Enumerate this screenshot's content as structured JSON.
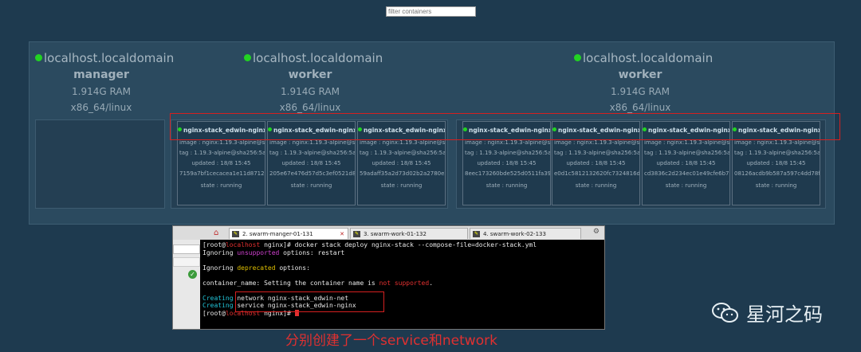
{
  "filter": {
    "placeholder": "filter containers"
  },
  "nodes": [
    {
      "host": "localhost.localdomain",
      "role": "manager",
      "ram": "1.914G RAM",
      "arch": "x86_64/linux"
    },
    {
      "host": "localhost.localdomain",
      "role": "worker",
      "ram": "1.914G RAM",
      "arch": "x86_64/linux"
    },
    {
      "host": "localhost.localdomain",
      "role": "worker",
      "ram": "1.914G RAM",
      "arch": "x86_64/linux"
    }
  ],
  "tasks": [
    {
      "name": "nginx-stack_edwin-nginx",
      "image": "image : nginx:1.19.3-alpine@sha25",
      "tag": "tag : 1.19.3-alpine@sha256:5aa44b",
      "updated": "updated : 18/8 15:45",
      "id": "7159a7bf1cecacea1e11d871214a1",
      "state": "state : running"
    },
    {
      "name": "nginx-stack_edwin-nginx",
      "image": "image : nginx:1.19.3-alpine@sha25",
      "tag": "tag : 1.19.3-alpine@sha256:5aa44b",
      "updated": "updated : 18/8 15:45",
      "id": "205e67e476d57d5c3ef0521d8d3fe",
      "state": "state : running"
    },
    {
      "name": "nginx-stack_edwin-nginx",
      "image": "image : nginx:1.19.3-alpine@sha25",
      "tag": "tag : 1.19.3-alpine@sha256:5aa44b",
      "updated": "updated : 18/8 15:45",
      "id": "59adaff35a2d73d02b2a2780e2ad6",
      "state": "state : running"
    },
    {
      "name": "nginx-stack_edwin-nginx",
      "image": "image : nginx:1.19.3-alpine@sha25",
      "tag": "tag : 1.19.3-alpine@sha256:5aa44b",
      "updated": "updated : 18/8 15:45",
      "id": "8eec173260bde525d0511fa3915c0",
      "state": "state : running"
    },
    {
      "name": "nginx-stack_edwin-nginx",
      "image": "image : nginx:1.19.3-alpine@sha25",
      "tag": "tag : 1.19.3-alpine@sha256:5aa44b",
      "updated": "updated : 18/8 15:45",
      "id": "e0d1c5812132620fc7324816da4e5",
      "state": "state : running"
    },
    {
      "name": "nginx-stack_edwin-nginx",
      "image": "image : nginx:1.19.3-alpine@sha25",
      "tag": "tag : 1.19.3-alpine@sha256:5aa44b",
      "updated": "updated : 18/8 15:45",
      "id": "cd3836c2d234ec01e49cfe6b73d90",
      "state": "state : running"
    },
    {
      "name": "nginx-stack_edwin-nginx",
      "image": "image : nginx:1.19.3-alpine@sha25",
      "tag": "tag : 1.19.3-alpine@sha256:5aa44b",
      "updated": "updated : 18/8 15:45",
      "id": "08126acdb9b587a597c4dd78fb57",
      "state": "state : running"
    }
  ],
  "terminal": {
    "tabs": [
      "2. swarm-manger-01-131",
      "3. swarm-work-01-132",
      "4. swarm-work-02-133"
    ],
    "prompt1_a": "[root@",
    "prompt1_host": "localhost",
    "prompt1_b": " nginx]# docker stack deploy nginx-stack --compose-file=docker-stack.yml",
    "ign1_a": "Ignoring ",
    "ign1_b": "unsupported",
    "ign1_c": " options: restart",
    "ign2_a": "Ignoring ",
    "ign2_b": "deprecated",
    "ign2_c": " options:",
    "cn_a": "container_name: Setting the container name is ",
    "cn_b": "not supported",
    "cn_c": ".",
    "creating": "Creating",
    "net": " network nginx-stack_edwin-net",
    "svc": " service nginx-stack_edwin-nginx",
    "prompt2_a": "[root@",
    "prompt2_host": "localhost",
    "prompt2_b": " nginx]# "
  },
  "caption": "分别创建了一个service和network",
  "watermark": "星河之码",
  "colors": {
    "background": "#1e3a4f",
    "running_dot": "#22d322",
    "highlight": "#d42020"
  }
}
